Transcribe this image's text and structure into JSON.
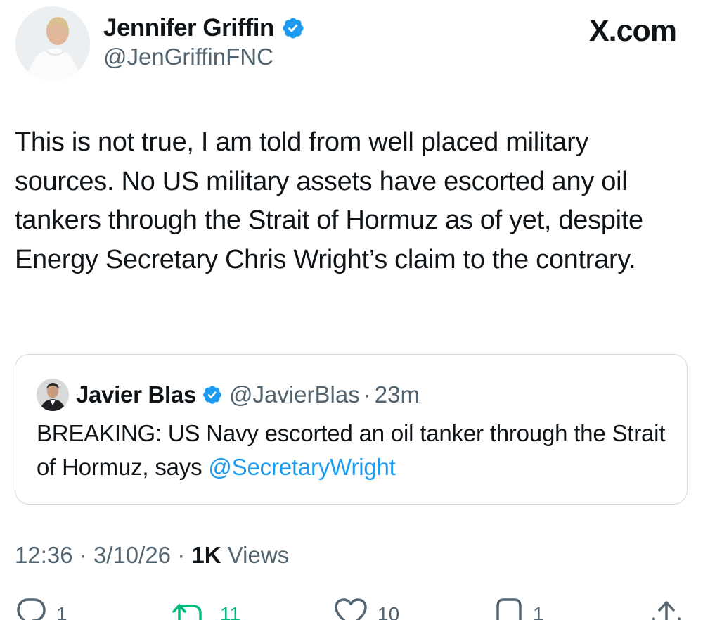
{
  "header": {
    "display_name": "Jennifer Griffin",
    "handle": "@JenGriffinFNC",
    "site_label": "X.com",
    "avatar_icon": "profile-photo",
    "verified_icon": "verified-badge-icon"
  },
  "tweet": {
    "text": "This is not true, I am told from well placed military sources. No US military assets have escorted any oil tankers through the Strait of Hormuz as of yet, despite Energy Secretary Chris Wright’s claim to the contrary."
  },
  "quote": {
    "display_name": "Javier Blas",
    "handle": "@JavierBlas",
    "separator": "·",
    "time": "23m",
    "text_prefix": "BREAKING: US Navy escorted an oil tanker through the Strait of Hormuz, says ",
    "mention": "@SecretaryWright"
  },
  "meta": {
    "time": "12:36",
    "sep1": " · ",
    "date": "3/10/26",
    "sep2": " · ",
    "views_count": "1K",
    "views_label": " Views"
  },
  "actions": {
    "replies": "1",
    "retweets": "11",
    "likes": "10",
    "bookmarks": "1"
  },
  "colors": {
    "text": "#0f1419",
    "secondary": "#536471",
    "accent_blue": "#1d9bf0",
    "retweet_green": "#00ba7c",
    "border": "#cfd9de"
  }
}
